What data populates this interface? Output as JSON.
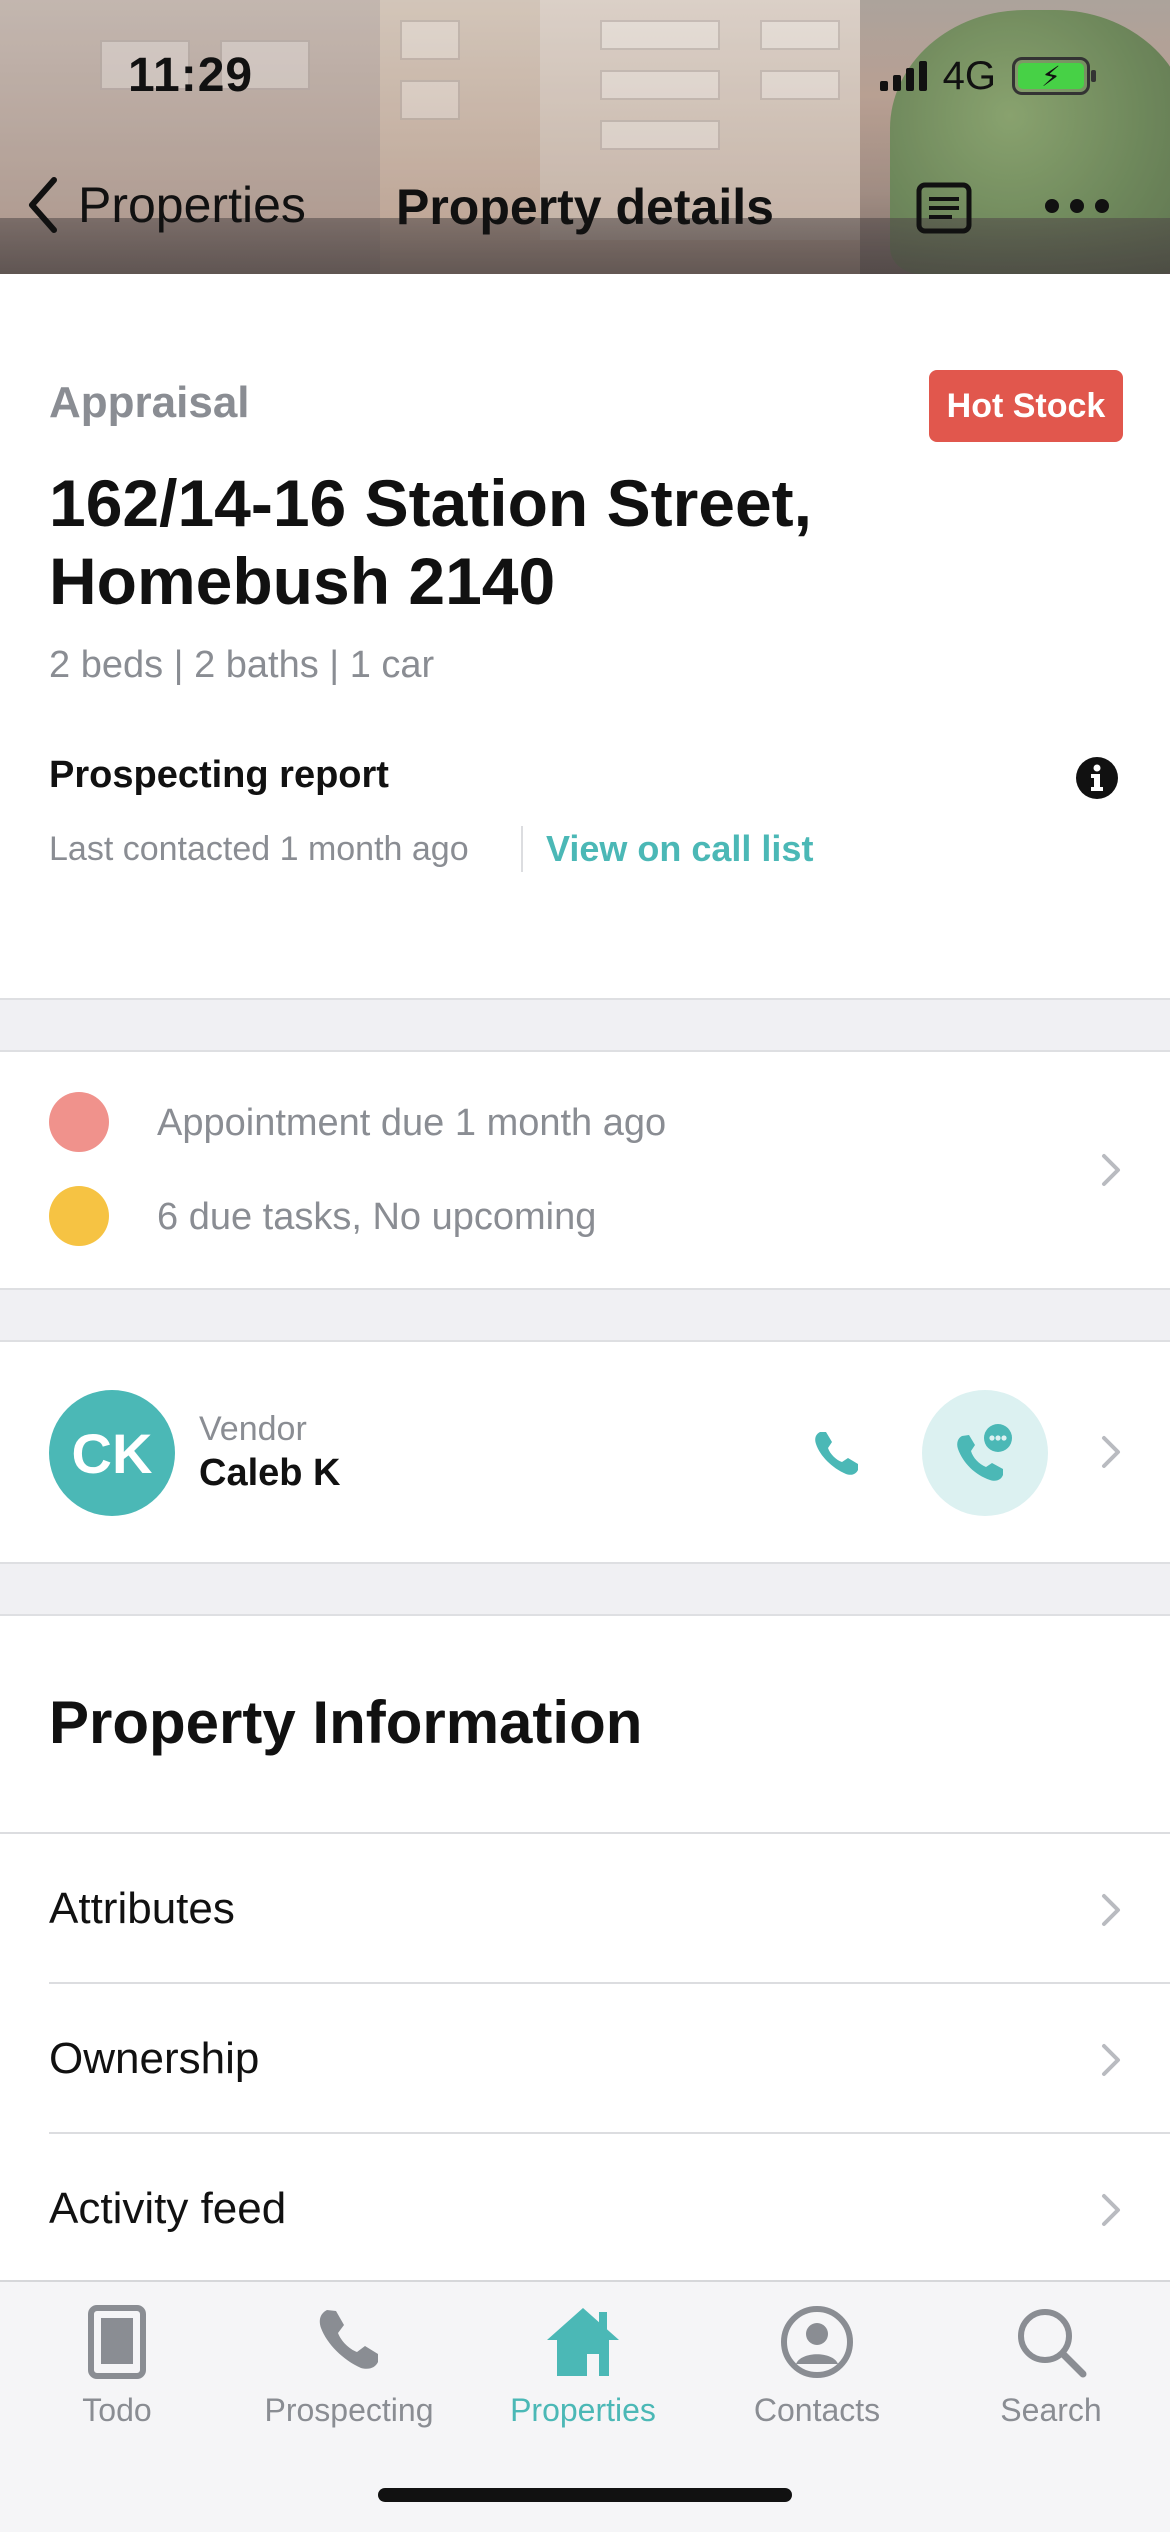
{
  "status_bar": {
    "time": "11:29",
    "network": "4G"
  },
  "nav": {
    "back_label": "Properties",
    "title": "Property details"
  },
  "summary": {
    "stage": "Appraisal",
    "badge": "Hot Stock",
    "address_line1": "162/14-16 Station Street,",
    "address_line2": "Homebush 2140",
    "features": "2 beds | 2 baths | 1 car",
    "report_title": "Prospecting report",
    "last_contacted": "Last contacted 1 month ago",
    "call_list_link": "View on call list"
  },
  "tasks": {
    "appointment": "Appointment due 1 month ago",
    "due_tasks": "6 due tasks, No upcoming",
    "appointment_color": "#f0928c",
    "tasks_color": "#f6c343"
  },
  "vendor": {
    "initials": "CK",
    "role": "Vendor",
    "name": "Caleb K"
  },
  "property_information": {
    "title": "Property Information",
    "rows": [
      {
        "label": "Attributes"
      },
      {
        "label": "Ownership"
      },
      {
        "label": "Activity feed"
      }
    ]
  },
  "tabbar": {
    "tabs": [
      {
        "label": "Todo",
        "icon": "todo-icon"
      },
      {
        "label": "Prospecting",
        "icon": "phone-icon"
      },
      {
        "label": "Properties",
        "icon": "home-icon",
        "active": true
      },
      {
        "label": "Contacts",
        "icon": "contact-icon"
      },
      {
        "label": "Search",
        "icon": "search-icon"
      }
    ]
  },
  "colors": {
    "accent": "#4bb8b6",
    "hot_stock": "#e1574d",
    "muted_text": "#8a8d93"
  }
}
